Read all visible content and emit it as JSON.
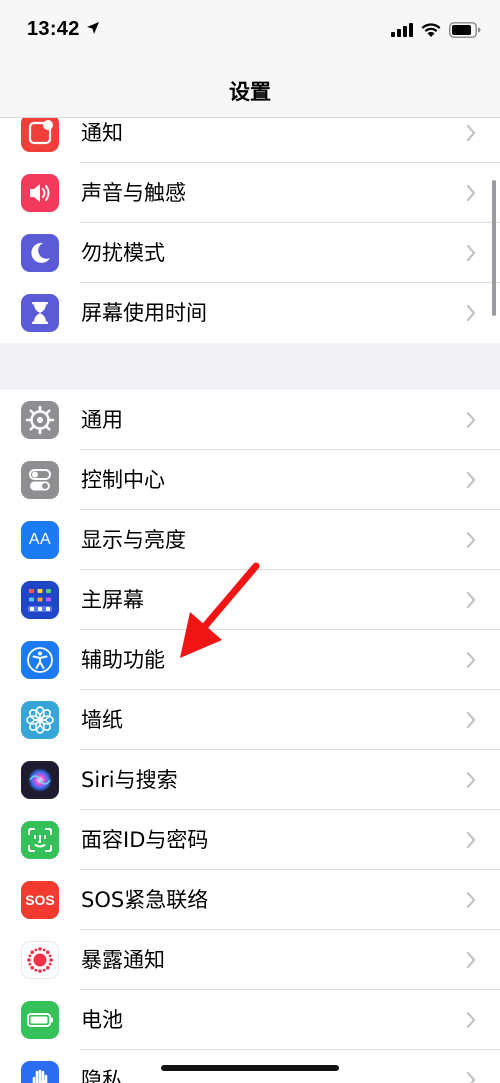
{
  "status": {
    "time": "13:42"
  },
  "nav": {
    "title": "设置"
  },
  "group1": [
    {
      "id": "notifications",
      "label": "通知",
      "icon": "notifications-icon",
      "color": "#f23e3a"
    },
    {
      "id": "sounds",
      "label": "声音与触感",
      "icon": "speaker-icon",
      "color": "#f33a5d"
    },
    {
      "id": "dnd",
      "label": "勿扰模式",
      "icon": "moon-icon",
      "color": "#5b5bd8"
    },
    {
      "id": "screen-time",
      "label": "屏幕使用时间",
      "icon": "hourglass-icon",
      "color": "#5b5bd8"
    }
  ],
  "group2": [
    {
      "id": "general",
      "label": "通用",
      "icon": "gear-icon",
      "color": "#8e8e93"
    },
    {
      "id": "control-center",
      "label": "控制中心",
      "icon": "toggles-icon",
      "color": "#8e8e93"
    },
    {
      "id": "display",
      "label": "显示与亮度",
      "icon": "text-size-icon",
      "color": "#1a7bf2",
      "glyph": "AA"
    },
    {
      "id": "home-screen",
      "label": "主屏幕",
      "icon": "app-grid-icon",
      "color": "#2046c8"
    },
    {
      "id": "accessibility",
      "label": "辅助功能",
      "icon": "accessibility-icon",
      "color": "#1a7bf2"
    },
    {
      "id": "wallpaper",
      "label": "墙纸",
      "icon": "flower-icon",
      "color": "#36a5d8"
    },
    {
      "id": "siri",
      "label": "Siri与搜索",
      "icon": "siri-icon",
      "color": "#1c1c2e"
    },
    {
      "id": "face-id",
      "label": "面容ID与密码",
      "icon": "face-id-icon",
      "color": "#35c15a"
    },
    {
      "id": "sos",
      "label": "SOS紧急联络",
      "icon": "sos-icon",
      "color": "#f23a30",
      "glyph": "SOS"
    },
    {
      "id": "exposure",
      "label": "暴露通知",
      "icon": "exposure-icon",
      "color": "#ffffff"
    },
    {
      "id": "battery",
      "label": "电池",
      "icon": "battery-icon",
      "color": "#35c15a"
    },
    {
      "id": "privacy",
      "label": "隐私",
      "icon": "hand-icon",
      "color": "#2a6cf2"
    }
  ]
}
